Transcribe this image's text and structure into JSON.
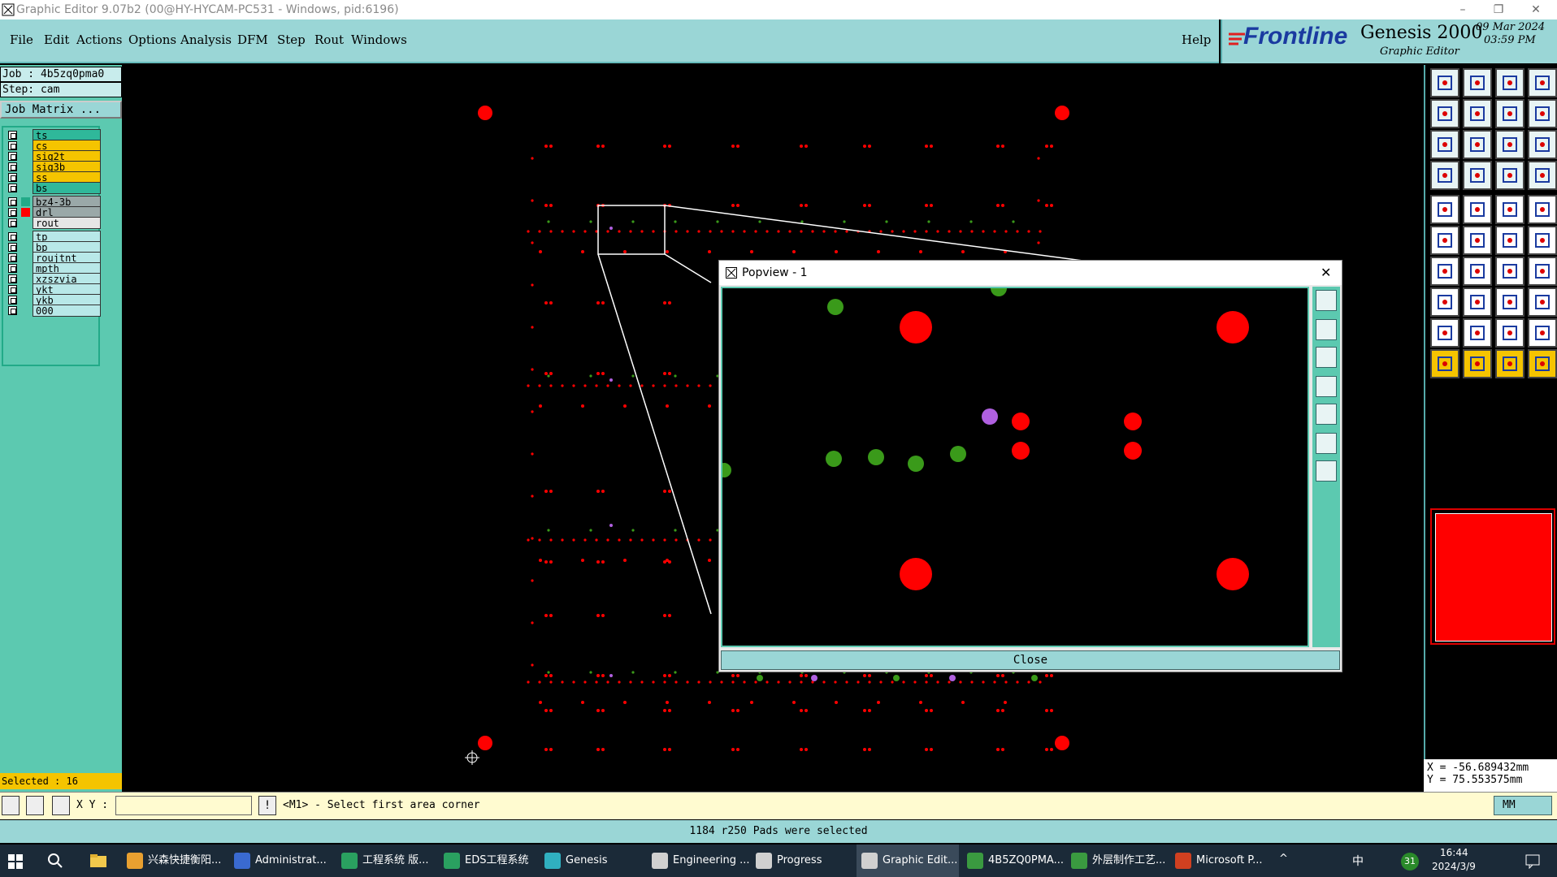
{
  "title_bar": {
    "title": "Graphic Editor 9.07b2 (00@HY-HYCAM-PC531 - Windows, pid:6196)"
  },
  "menu": {
    "items": [
      "File",
      "Edit",
      "Actions",
      "Options",
      "Analysis",
      "DFM",
      "Step",
      "Rout",
      "Windows"
    ],
    "help": "Help"
  },
  "brand": {
    "logo": "Frontline",
    "product": "Genesis 2000",
    "subtitle": "Graphic Editor",
    "date": "09 Mar 2024",
    "time": "03:59 PM"
  },
  "job": {
    "job_line": "Job : 4b5zq0pma0",
    "step_line": "Step: cam",
    "matrix_button": "Job Matrix ..."
  },
  "layers": [
    {
      "name": "ts",
      "color": "#2fb89a"
    },
    {
      "name": "cs",
      "color": "#f5c400"
    },
    {
      "name": "sig2t",
      "color": "#f5c400"
    },
    {
      "name": "sig3b",
      "color": "#f5c400"
    },
    {
      "name": "ss",
      "color": "#f5c400"
    },
    {
      "name": "bs",
      "color": "#2fb89a"
    },
    {
      "name": "bz4-3b",
      "color": "#9aa8a8"
    },
    {
      "name": "drl",
      "color": "#9aa8a8"
    },
    {
      "name": "rout",
      "color": "#e6e6e6"
    },
    {
      "name": "tp",
      "color": "#b8e8e8"
    },
    {
      "name": "bp",
      "color": "#b8e8e8"
    },
    {
      "name": "roujtnt",
      "color": "#b8e8e8"
    },
    {
      "name": "mpth",
      "color": "#b8e8e8"
    },
    {
      "name": "xzszvia",
      "color": "#b8e8e8"
    },
    {
      "name": "ykt",
      "color": "#b8e8e8"
    },
    {
      "name": "ykb",
      "color": "#b8e8e8"
    },
    {
      "name": "000",
      "color": "#b8e8e8"
    }
  ],
  "selected_label": "Selected : 16",
  "coords": {
    "x": "X = -56.689432mm",
    "y": "Y = 75.553575mm"
  },
  "command": {
    "xy_label": "X Y :",
    "input_value": "",
    "prompt": "<M1> - Select first area corner",
    "units": "MM"
  },
  "status_message": "1184 r250 Pads were selected",
  "popview": {
    "title": "Popview - 1",
    "close_label": "Close"
  },
  "taskbar": {
    "apps": [
      "兴森快捷衡阳...",
      "Administrat...",
      "工程系统  版...",
      "EDS工程系统",
      "Genesis",
      "Engineering ...",
      "Progress",
      "Graphic Edit...",
      "4B5ZQ0PMA...",
      "外层制作工艺...",
      "Microsoft P..."
    ],
    "ime": "中",
    "badge": "31",
    "clock": "16:44",
    "date": "2024/3/9"
  },
  "colors": {
    "accent": "#9ad6d6",
    "panel": "#5cc9b0",
    "pad_red": "#ff0000",
    "pad_green": "#3a9a1a",
    "pad_purple": "#b060e0"
  }
}
